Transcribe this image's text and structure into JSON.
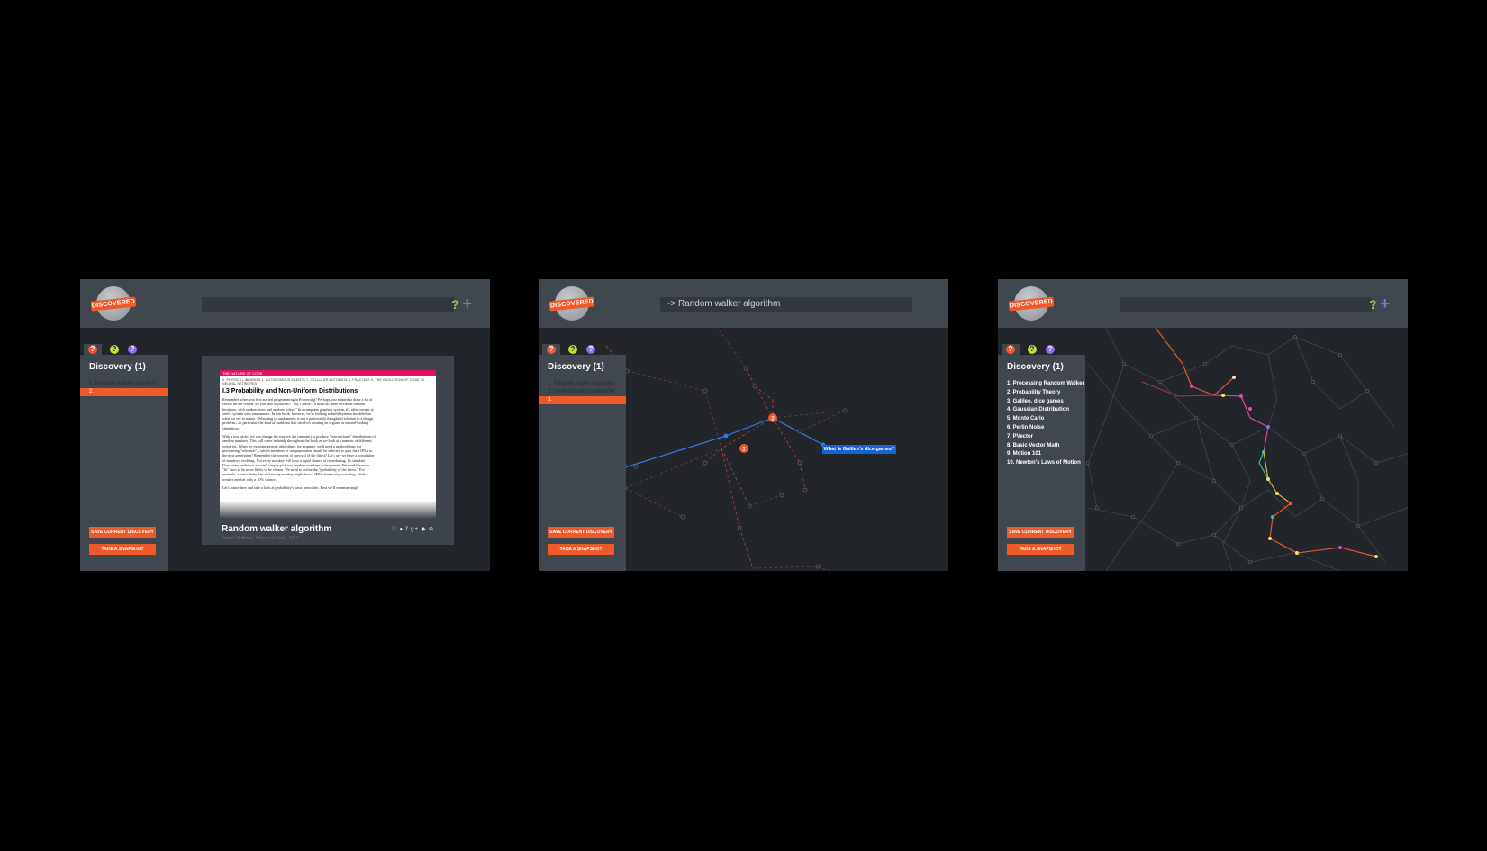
{
  "colors": {
    "accent": "#ef5a2a",
    "header": "#41474e",
    "canvas": "#22262b",
    "highlight": "#1565d8"
  },
  "icons": [
    "orange-help-icon",
    "green-help-icon",
    "purple-help-icon",
    "question-icon",
    "plus-icon"
  ],
  "logo_text": "DISCOVERED",
  "help_mark": "?",
  "plus_mark": "+",
  "tab_marks": [
    "?",
    "?",
    "?"
  ],
  "screen1": {
    "search_value": "",
    "sidebar_title": "Discovery (1)",
    "items": [
      "1.  Random walker algorithm",
      "2."
    ],
    "save_label": "SAVE CURRENT DISCOVERY",
    "snapshot_label": "TAKE A SNAPSHOT",
    "doc": {
      "bar": "THE NATURE OF CODE",
      "nav": "0. PHYSICS LIBRARIES   1. AUTONOMOUS AGENTS   7. CELLULAR AUTOMATA   8. FRACTALS   9. THE EVOLUTION OF CODE   10. NEURAL NETWORKS",
      "heading": "I.3 Probability and Non-Uniform Distributions",
      "p1": "Remember when you first started programming in Processing? Perhaps you wanted to draw a lot of circles on the screen. So you said to yourself: \"Oh, I know. I'll draw all these circles at random locations, with random sizes and random colors.\" In a computer graphics system, it's often easiest to seed a system with randomness. In this book, however, we're looking to build systems modeled on what we see in nature. Defaulting to randomness is not a particularly thoughtful solution to a design problem—in particular, the kind of problems that involves creating an organic or natural-looking simulation.",
      "p2": "With a few tricks, we can change the way we use random() to produce \"non-uniform\" distributions of random numbers. This will come in handy throughout the book as we look at a number of different scenarios. When we examine genetic algorithms, for example, we'll need a methodology for performing \"selection\"—which members of our population should be selected to pass their DNA to the next generation? Remember the concept of survival of the fittest? Let's say we have a population of monkeys evolving. Not every monkey will have a equal chance of reproducing. To simulate Darwinian evolution, we can't simply pick two random monkeys to be parents. We need the more \"fit\" ones to be more likely to be chosen. We need to define the \"probability of the fittest.\" For example, a particularly fast and strong monkey might have a 90% chance of procreating, while a weaker one has only a 10% chance.",
      "p3": "Let's pause here and take a look at probability's basic principles. First we'll examine single"
    },
    "card_title": "Random walker algorithm",
    "card_sub": "Daniel Shiffman, Nature of Code, 2012",
    "social_icons": "♡ ● f g+ ◆ ⊕"
  },
  "screen2": {
    "search_value": "-> Random walker algorithm",
    "sidebar_title": "Discovery (1)",
    "items": [
      "1.  Random walker algorithm",
      "2.  Understanding probability",
      "3."
    ],
    "save_label": "SAVE CURRENT DISCOVERY",
    "snapshot_label": "TAKE A SNAPSHOT",
    "node1": "1",
    "node2": "2",
    "tooltip": "What is Galileo's dice games?"
  },
  "screen3": {
    "search_value": "",
    "sidebar_title": "Discovery (1)",
    "items": [
      "1. Processing Random Walker",
      "2. Probability Theory",
      "3. Galileo, dice games",
      "4. Gaussian Distribution",
      "5. Monte Carlo",
      "6. Perlin Noise",
      "7. PVector",
      "8. Basic Vector Math",
      "9. Motion 101",
      "10. Newton's Laws of Motion"
    ],
    "save_label": "SAVE CURRENT DISCOVERY",
    "snapshot_label": "TAKE A SNAPSHOT"
  }
}
